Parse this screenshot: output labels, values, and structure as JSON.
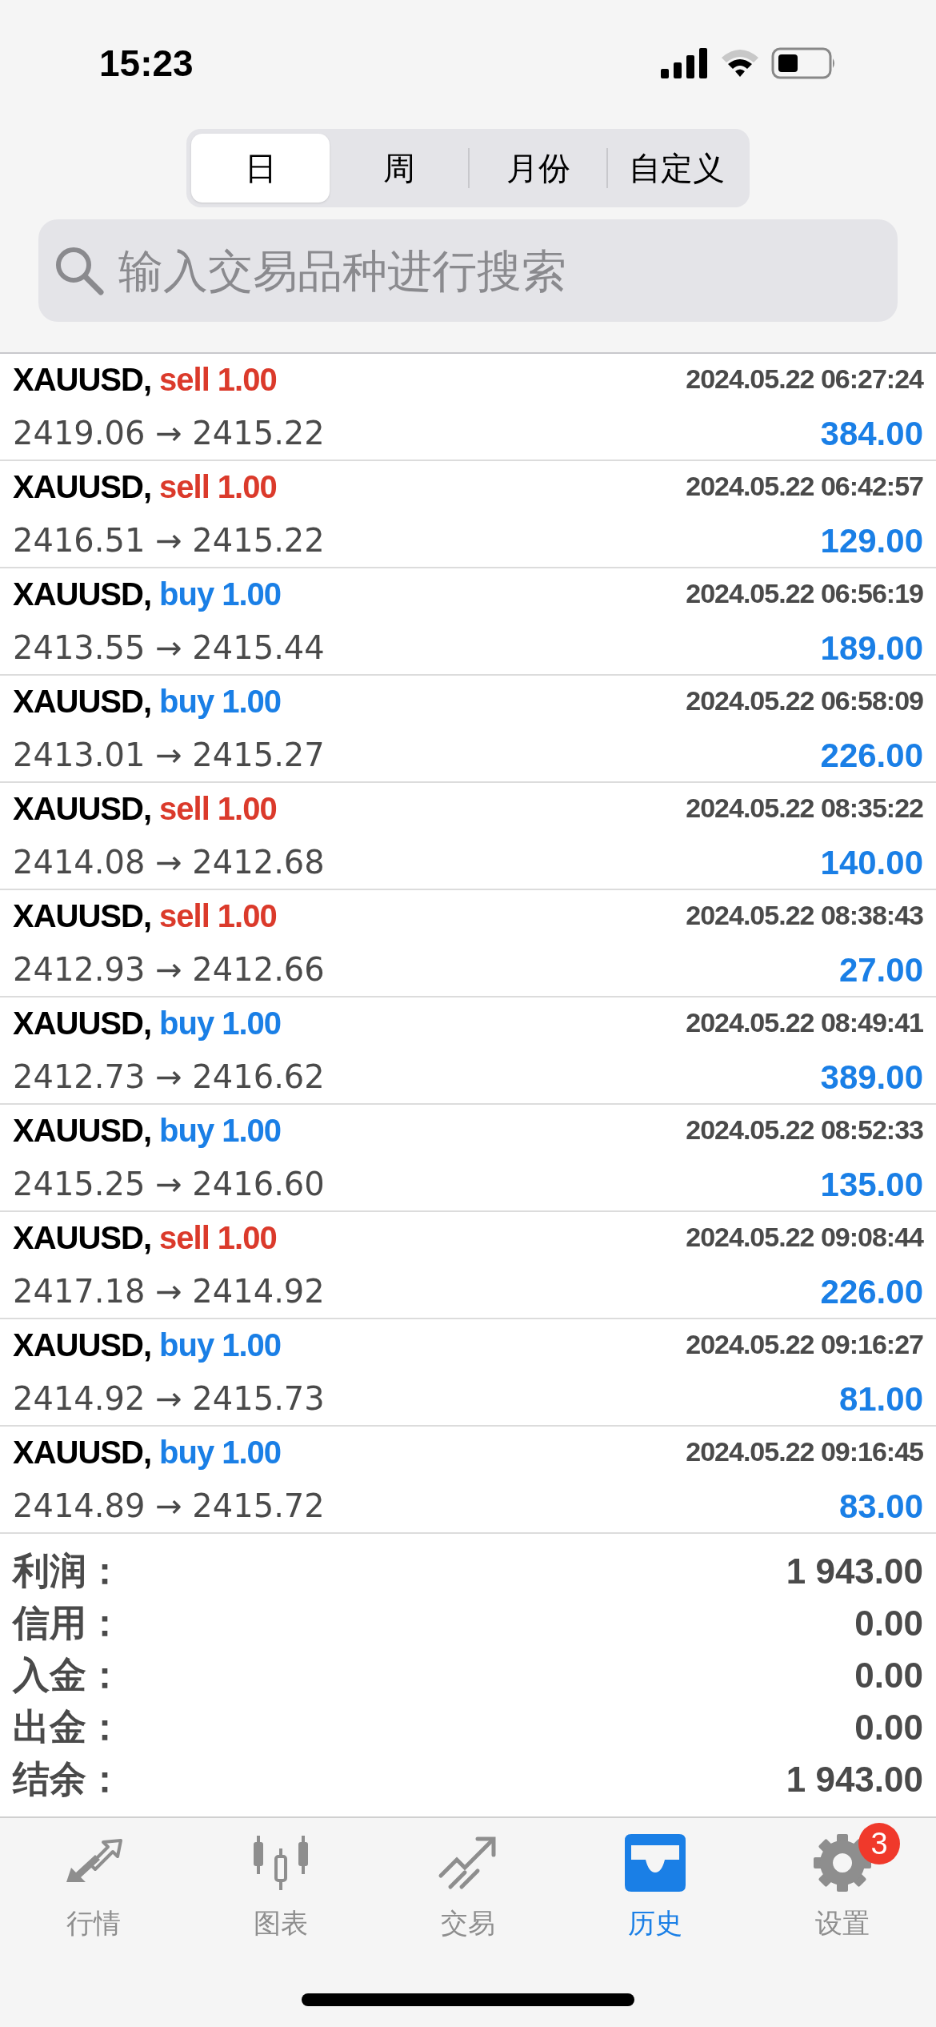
{
  "status_bar": {
    "time": "15:23"
  },
  "period_tabs": [
    {
      "label": "日",
      "selected": true
    },
    {
      "label": "周",
      "selected": false
    },
    {
      "label": "月份",
      "selected": false
    },
    {
      "label": "自定义",
      "selected": false
    }
  ],
  "search": {
    "placeholder": "输入交易品种进行搜索"
  },
  "trades": [
    {
      "symbol": "XAUUSD,",
      "order": "sell 1.00",
      "kind": "sell",
      "time": "2024.05.22 06:27:24",
      "prices": "2419.06 → 2415.22",
      "profit": "384.00"
    },
    {
      "symbol": "XAUUSD,",
      "order": "sell 1.00",
      "kind": "sell",
      "time": "2024.05.22 06:42:57",
      "prices": "2416.51 → 2415.22",
      "profit": "129.00"
    },
    {
      "symbol": "XAUUSD,",
      "order": "buy 1.00",
      "kind": "buy",
      "time": "2024.05.22 06:56:19",
      "prices": "2413.55 → 2415.44",
      "profit": "189.00"
    },
    {
      "symbol": "XAUUSD,",
      "order": "buy 1.00",
      "kind": "buy",
      "time": "2024.05.22 06:58:09",
      "prices": "2413.01 → 2415.27",
      "profit": "226.00"
    },
    {
      "symbol": "XAUUSD,",
      "order": "sell 1.00",
      "kind": "sell",
      "time": "2024.05.22 08:35:22",
      "prices": "2414.08 → 2412.68",
      "profit": "140.00"
    },
    {
      "symbol": "XAUUSD,",
      "order": "sell 1.00",
      "kind": "sell",
      "time": "2024.05.22 08:38:43",
      "prices": "2412.93 → 2412.66",
      "profit": "27.00"
    },
    {
      "symbol": "XAUUSD,",
      "order": "buy 1.00",
      "kind": "buy",
      "time": "2024.05.22 08:49:41",
      "prices": "2412.73 → 2416.62",
      "profit": "389.00"
    },
    {
      "symbol": "XAUUSD,",
      "order": "buy 1.00",
      "kind": "buy",
      "time": "2024.05.22 08:52:33",
      "prices": "2415.25 → 2416.60",
      "profit": "135.00"
    },
    {
      "symbol": "XAUUSD,",
      "order": "sell 1.00",
      "kind": "sell",
      "time": "2024.05.22 09:08:44",
      "prices": "2417.18 → 2414.92",
      "profit": "226.00"
    },
    {
      "symbol": "XAUUSD,",
      "order": "buy 1.00",
      "kind": "buy",
      "time": "2024.05.22 09:16:27",
      "prices": "2414.92 → 2415.73",
      "profit": "81.00"
    },
    {
      "symbol": "XAUUSD,",
      "order": "buy 1.00",
      "kind": "buy",
      "time": "2024.05.22 09:16:45",
      "prices": "2414.89 → 2415.72",
      "profit": "83.00"
    }
  ],
  "summary": [
    {
      "label": "利润：",
      "value": "1 943.00"
    },
    {
      "label": "信用：",
      "value": "0.00"
    },
    {
      "label": "入金：",
      "value": "0.00"
    },
    {
      "label": "出金：",
      "value": "0.00"
    },
    {
      "label": "结余：",
      "value": "1 943.00"
    }
  ],
  "bottom_tabs": [
    {
      "label": "行情",
      "kind": "quotes",
      "selected": false
    },
    {
      "label": "图表",
      "kind": "chart",
      "selected": false
    },
    {
      "label": "交易",
      "kind": "trade",
      "selected": false
    },
    {
      "label": "历史",
      "kind": "history",
      "selected": true
    },
    {
      "label": "设置",
      "kind": "settings",
      "selected": false,
      "badge": "3"
    }
  ]
}
